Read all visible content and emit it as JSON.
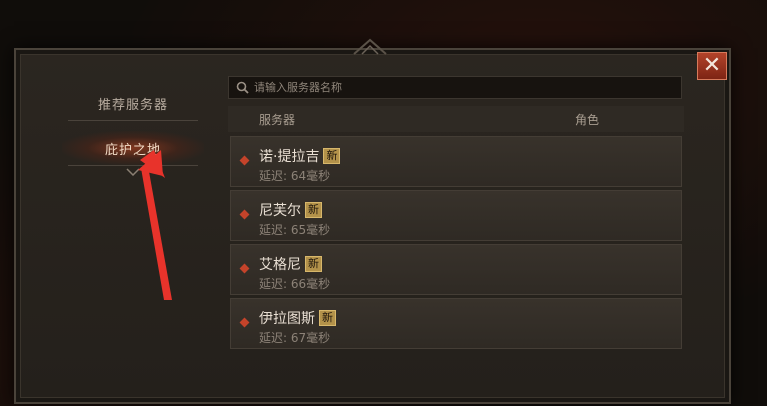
{
  "sidebar": {
    "items": [
      {
        "label": "推荐服务器",
        "active": false
      },
      {
        "label": "庇护之地",
        "active": true
      }
    ]
  },
  "search": {
    "placeholder": "请输入服务器名称",
    "icon": "search-icon"
  },
  "table": {
    "col_server": "服务器",
    "col_role": "角色"
  },
  "servers": [
    {
      "name": "诺·提拉吉",
      "badge": "新",
      "latency_label": "延迟:",
      "latency": "64毫秒"
    },
    {
      "name": "尼芙尔",
      "badge": "新",
      "latency_label": "延迟:",
      "latency": "65毫秒"
    },
    {
      "name": "艾格尼",
      "badge": "新",
      "latency_label": "延迟:",
      "latency": "66毫秒"
    },
    {
      "name": "伊拉图斯",
      "badge": "新",
      "latency_label": "延迟:",
      "latency": "67毫秒"
    }
  ],
  "close": {
    "icon": "close-icon",
    "symbol": "✕"
  },
  "colors": {
    "accent": "#c4432a",
    "badge": "#b3924a",
    "annotation_arrow": "#e8332b"
  }
}
